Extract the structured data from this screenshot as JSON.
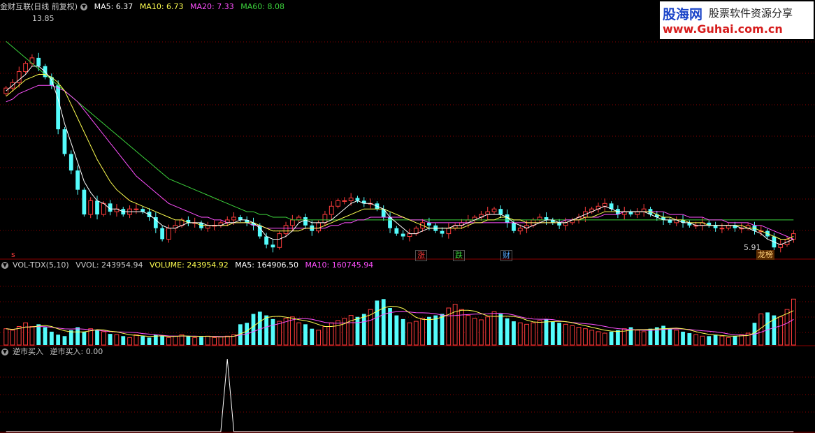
{
  "header": {
    "title": "金财互联(日线 前复权)",
    "ma5": "MA5: 6.37",
    "ma10": "MA10: 6.73",
    "ma20": "MA20: 7.33",
    "ma60": "MA60: 8.08"
  },
  "vol_header": {
    "name": "VOL-TDX(5,10)",
    "vvol": "VVOL: 243954.94",
    "volume": "VOLUME: 243954.92",
    "ma5": "MA5: 164906.50",
    "ma10": "MA10: 160745.94"
  },
  "ind_header": {
    "name": "逆市买入",
    "value": "逆市买入: 0.00"
  },
  "watermark": {
    "line1": "股海网",
    "line1b": "股票软件资源分享",
    "line2": "www.Guhai.com.cn"
  },
  "markers": {
    "zhang": "涨",
    "die": "跌",
    "cai": "财",
    "s": "s",
    "longhu": "龙榜",
    "high_label": "13.85",
    "low_label": "5.91"
  },
  "colors": {
    "up": "#ff3c3c",
    "down": "#54fcfc",
    "ma5": "#ffffff",
    "ma10": "#ffff50",
    "ma20": "#ff50ff",
    "ma60": "#3cd23c",
    "grid": "#8b0000",
    "header_title": "#cccccc"
  },
  "chart_data": {
    "type": "candlestick",
    "title": "金财互联(日线 前复权)",
    "price_range": [
      5.5,
      14.5
    ],
    "close": [
      11.7,
      11.9,
      12.3,
      12.6,
      12.8,
      12.5,
      12.1,
      11.8,
      10.2,
      9.3,
      8.7,
      8.0,
      7.1,
      7.6,
      7.1,
      7.5,
      7.2,
      7.3,
      7.1,
      7.3,
      7.3,
      7.2,
      7.0,
      6.6,
      6.2,
      6.6,
      6.7,
      6.9,
      6.8,
      6.8,
      6.6,
      6.7,
      6.7,
      6.8,
      6.9,
      7.0,
      6.9,
      6.8,
      6.7,
      6.3,
      6.0,
      5.9,
      6.4,
      6.7,
      6.9,
      7.0,
      6.7,
      6.5,
      6.8,
      7.1,
      7.4,
      7.6,
      7.6,
      7.7,
      7.6,
      7.5,
      7.5,
      7.3,
      7.0,
      6.6,
      6.4,
      6.3,
      6.4,
      6.6,
      6.8,
      6.7,
      6.5,
      6.4,
      6.6,
      6.7,
      6.8,
      6.9,
      7.0,
      7.1,
      7.2,
      7.3,
      7.1,
      6.8,
      6.5,
      6.6,
      6.7,
      6.9,
      7.0,
      6.9,
      6.8,
      6.7,
      6.8,
      6.9,
      7.0,
      7.2,
      7.3,
      7.4,
      7.5,
      7.3,
      7.1,
      7.2,
      7.1,
      7.2,
      7.3,
      7.1,
      7.0,
      6.9,
      6.8,
      6.9,
      6.8,
      6.7,
      6.7,
      6.8,
      6.7,
      6.6,
      6.6,
      6.7,
      6.6,
      6.6,
      6.7,
      6.5,
      6.5,
      6.3,
      5.9,
      6.0,
      6.2,
      6.4
    ],
    "volume_pct": [
      22,
      20,
      25,
      30,
      25,
      28,
      24,
      18,
      14,
      12,
      20,
      24,
      18,
      22,
      20,
      18,
      15,
      14,
      12,
      10,
      14,
      12,
      10,
      14,
      12,
      10,
      12,
      14,
      12,
      10,
      11,
      12,
      10,
      11,
      12,
      14,
      28,
      30,
      42,
      45,
      40,
      35,
      32,
      36,
      38,
      30,
      28,
      22,
      20,
      25,
      30,
      33,
      36,
      40,
      38,
      42,
      48,
      60,
      62,
      50,
      40,
      35,
      30,
      32,
      36,
      38,
      40,
      42,
      50,
      55,
      48,
      40,
      36,
      34,
      38,
      45,
      42,
      36,
      32,
      30,
      28,
      30,
      33,
      35,
      32,
      30,
      28,
      26,
      24,
      22,
      20,
      18,
      16,
      18,
      20,
      22,
      24,
      20,
      18,
      22,
      24,
      26,
      22,
      20,
      18,
      16,
      14,
      12,
      12,
      14,
      12,
      10,
      12,
      14,
      16,
      30,
      42,
      44,
      40,
      38,
      48,
      62
    ],
    "ma5": [
      11.6,
      11.8,
      12.0,
      12.2,
      12.5,
      12.5,
      12.3,
      12.0,
      11.3,
      10.4,
      9.7,
      9.0,
      8.3,
      7.9,
      7.6,
      7.5,
      7.3,
      7.3,
      7.2,
      7.2,
      7.2,
      7.2,
      7.1,
      6.9,
      6.7,
      6.6,
      6.6,
      6.7,
      6.8,
      6.8,
      6.8,
      6.7,
      6.7,
      6.7,
      6.8,
      6.8,
      6.9,
      6.9,
      6.8,
      6.6,
      6.3,
      6.2,
      6.2,
      6.3,
      6.5,
      6.8,
      6.9,
      6.8,
      6.8,
      6.8,
      6.9,
      7.1,
      7.3,
      7.5,
      7.6,
      7.5,
      7.5,
      7.4,
      7.3,
      7.0,
      6.8,
      6.6,
      6.4,
      6.4,
      6.5,
      6.6,
      6.6,
      6.6,
      6.6,
      6.7,
      6.7,
      6.8,
      6.9,
      7.0,
      7.1,
      7.1,
      7.1,
      7.0,
      6.8,
      6.7,
      6.6,
      6.7,
      6.8,
      6.9,
      6.9,
      6.8,
      6.8,
      6.9,
      7.0,
      7.1,
      7.2,
      7.3,
      7.4,
      7.3,
      7.2,
      7.2,
      7.2,
      7.2,
      7.2,
      7.1,
      7.0,
      6.9,
      6.9,
      6.9,
      6.8,
      6.8,
      6.7,
      6.7,
      6.7,
      6.7,
      6.7,
      6.7,
      6.7,
      6.6,
      6.6,
      6.5,
      6.4,
      6.2,
      6.1,
      6.0,
      6.1,
      6.2
    ],
    "ma10": [
      11.4,
      11.6,
      11.8,
      12.0,
      12.1,
      12.2,
      12.2,
      12.1,
      11.9,
      11.6,
      11.1,
      10.6,
      10.1,
      9.6,
      9.1,
      8.7,
      8.3,
      8.0,
      7.8,
      7.6,
      7.5,
      7.4,
      7.3,
      7.2,
      7.1,
      7.0,
      6.9,
      6.9,
      6.8,
      6.8,
      6.7,
      6.7,
      6.7,
      6.7,
      6.7,
      6.8,
      6.8,
      6.8,
      6.8,
      6.7,
      6.6,
      6.5,
      6.5,
      6.5,
      6.5,
      6.5,
      6.6,
      6.6,
      6.6,
      6.7,
      6.8,
      6.9,
      7.0,
      7.1,
      7.2,
      7.3,
      7.3,
      7.3,
      7.3,
      7.2,
      7.1,
      7.0,
      6.9,
      6.8,
      6.7,
      6.6,
      6.6,
      6.6,
      6.6,
      6.6,
      6.6,
      6.7,
      6.8,
      6.8,
      6.9,
      6.9,
      7.0,
      7.0,
      6.9,
      6.9,
      6.8,
      6.8,
      6.8,
      6.8,
      6.8,
      6.8,
      6.8,
      6.9,
      6.9,
      7.0,
      7.0,
      7.1,
      7.2,
      7.2,
      7.2,
      7.2,
      7.2,
      7.2,
      7.2,
      7.2,
      7.1,
      7.0,
      7.0,
      6.9,
      6.9,
      6.8,
      6.8,
      6.8,
      6.7,
      6.7,
      6.7,
      6.7,
      6.7,
      6.7,
      6.6,
      6.6,
      6.5,
      6.4,
      6.3,
      6.2,
      6.2,
      6.3
    ],
    "ma20": [
      11.2,
      11.3,
      11.5,
      11.6,
      11.7,
      11.8,
      11.8,
      11.8,
      11.7,
      11.6,
      11.4,
      11.2,
      10.9,
      10.6,
      10.3,
      10.0,
      9.7,
      9.4,
      9.1,
      8.8,
      8.5,
      8.3,
      8.1,
      7.9,
      7.7,
      7.5,
      7.4,
      7.3,
      7.2,
      7.1,
      7.0,
      7.0,
      6.9,
      6.9,
      6.8,
      6.8,
      6.8,
      6.8,
      6.7,
      6.7,
      6.6,
      6.6,
      6.6,
      6.6,
      6.6,
      6.6,
      6.6,
      6.6,
      6.6,
      6.6,
      6.7,
      6.7,
      6.8,
      6.8,
      6.9,
      6.9,
      7.0,
      7.0,
      7.0,
      7.0,
      7.0,
      7.0,
      6.9,
      6.9,
      6.9,
      6.8,
      6.8,
      6.8,
      6.8,
      6.8,
      6.8,
      6.8,
      6.8,
      6.8,
      6.8,
      6.8,
      6.8,
      6.8,
      6.8,
      6.8,
      6.8,
      6.8,
      6.8,
      6.8,
      6.8,
      6.8,
      6.9,
      6.9,
      6.9,
      7.0,
      7.0,
      7.0,
      7.1,
      7.1,
      7.1,
      7.2,
      7.2,
      7.2,
      7.2,
      7.2,
      7.2,
      7.2,
      7.1,
      7.1,
      7.1,
      7.0,
      7.0,
      7.0,
      6.9,
      6.9,
      6.9,
      6.8,
      6.8,
      6.8,
      6.8,
      6.7,
      6.7,
      6.6,
      6.5,
      6.4,
      6.3,
      6.2
    ],
    "ma60": [
      13.4,
      13.2,
      13.0,
      12.8,
      12.6,
      12.4,
      12.2,
      12.0,
      11.8,
      11.6,
      11.4,
      11.2,
      11.0,
      10.8,
      10.6,
      10.4,
      10.2,
      10.0,
      9.8,
      9.6,
      9.4,
      9.2,
      9.0,
      8.8,
      8.6,
      8.4,
      8.3,
      8.2,
      8.1,
      8.0,
      7.9,
      7.8,
      7.7,
      7.6,
      7.5,
      7.4,
      7.3,
      7.2,
      7.2,
      7.1,
      7.1,
      7.0,
      7.0,
      7.0,
      6.9,
      6.9,
      6.9,
      6.9,
      6.9,
      6.9,
      6.9,
      6.9,
      6.9,
      6.9,
      6.9,
      6.9,
      6.9,
      6.9,
      6.9,
      6.9,
      6.9,
      6.9,
      6.9,
      6.9,
      6.9,
      6.9,
      6.9,
      6.9,
      6.9,
      6.9,
      6.9,
      6.9,
      6.9,
      6.9,
      6.9,
      6.9,
      6.9,
      6.9,
      6.9,
      6.9,
      6.9,
      6.9,
      6.9,
      6.9,
      6.9,
      6.9,
      6.9,
      6.9,
      6.9,
      6.9,
      6.9,
      6.9,
      6.9,
      6.9,
      6.9,
      6.9,
      6.9,
      6.9,
      6.9,
      6.9,
      6.9,
      6.9,
      6.9,
      6.9,
      6.9,
      6.9,
      6.9,
      6.9,
      6.9,
      6.9,
      6.9,
      6.9,
      6.9,
      6.9,
      6.9,
      6.9,
      6.9,
      6.9,
      6.9,
      6.9,
      6.9,
      6.9
    ],
    "indicator": [
      0,
      0,
      0,
      0,
      0,
      0,
      0,
      0,
      0,
      0,
      0,
      0,
      0,
      0,
      0,
      0,
      0,
      0,
      0,
      0,
      0,
      0,
      0,
      0,
      0,
      0,
      0,
      0,
      0,
      0,
      0,
      0,
      0,
      0,
      1,
      0,
      0,
      0,
      0,
      0,
      0,
      0,
      0,
      0,
      0,
      0,
      0,
      0,
      0,
      0,
      0,
      0,
      0,
      0,
      0,
      0,
      0,
      0,
      0,
      0,
      0,
      0,
      0,
      0,
      0,
      0,
      0,
      0,
      0,
      0,
      0,
      0,
      0,
      0,
      0,
      0,
      0,
      0,
      0,
      0,
      0,
      0,
      0,
      0,
      0,
      0,
      0,
      0,
      0,
      0,
      0,
      0,
      0,
      0,
      0,
      0,
      0,
      0,
      0,
      0,
      0,
      0,
      0,
      0,
      0,
      0,
      0,
      0,
      0,
      0,
      0,
      0,
      0,
      0,
      0,
      0,
      0,
      0,
      0,
      0,
      0,
      0
    ]
  }
}
